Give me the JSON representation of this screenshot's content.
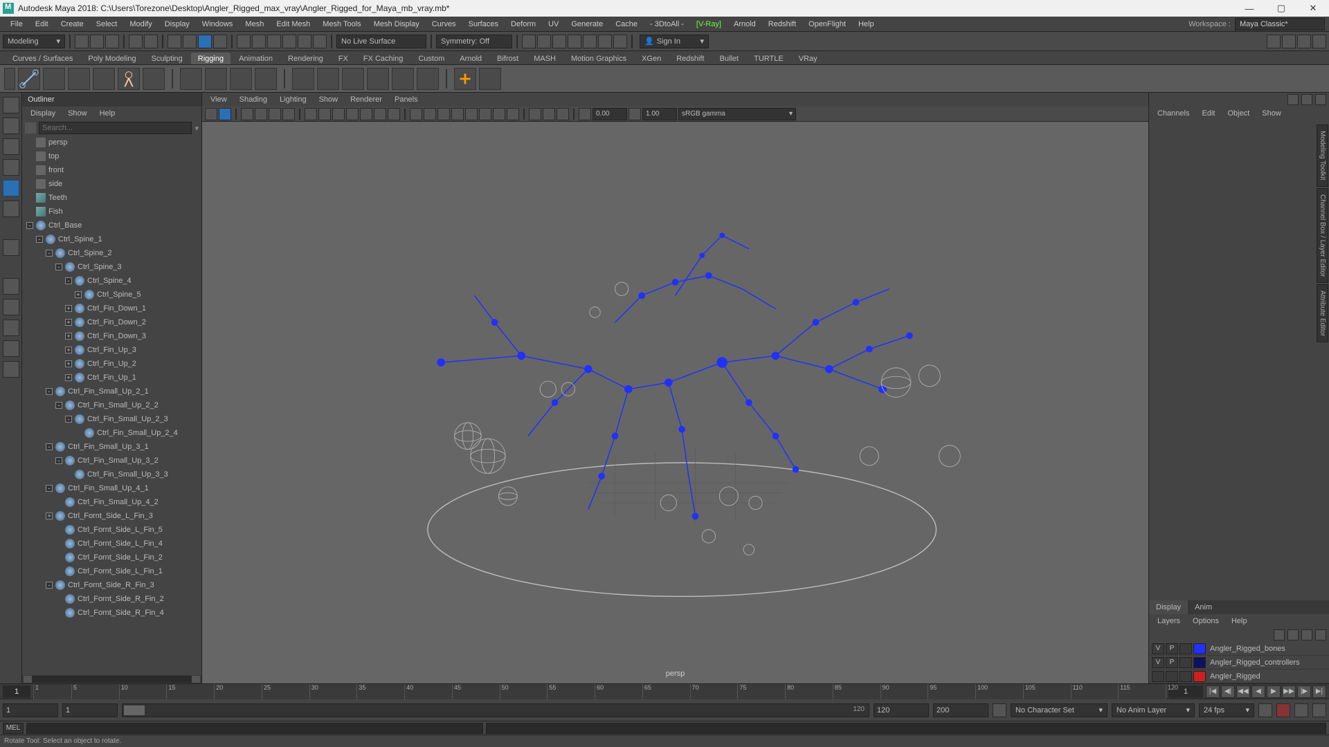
{
  "title": "Autodesk Maya 2018: C:\\Users\\Torezone\\Desktop\\Angler_Rigged_max_vray\\Angler_Rigged_for_Maya_mb_vray.mb*",
  "menubar": [
    "File",
    "Edit",
    "Create",
    "Select",
    "Modify",
    "Display",
    "Windows",
    "Mesh",
    "Edit Mesh",
    "Mesh Tools",
    "Mesh Display",
    "Curves",
    "Surfaces",
    "Deform",
    "UV",
    "Generate",
    "Cache",
    "- 3DtoAll -",
    "[V-Ray]",
    "Arnold",
    "Redshift",
    "OpenFlight",
    "Help"
  ],
  "workspace": {
    "label": "Workspace :",
    "value": "Maya Classic*"
  },
  "modeline": {
    "dropdown": "Modeling",
    "live_surface": "No Live Surface",
    "symmetry": "Symmetry: Off",
    "signin": "Sign In"
  },
  "shelf_tabs": [
    "Curves / Surfaces",
    "Poly Modeling",
    "Sculpting",
    "Rigging",
    "Animation",
    "Rendering",
    "FX",
    "FX Caching",
    "Custom",
    "Arnold",
    "Bifrost",
    "MASH",
    "Motion Graphics",
    "XGen",
    "Redshift",
    "Bullet",
    "TURTLE",
    "VRay"
  ],
  "shelf_active": "Rigging",
  "outliner": {
    "title": "Outliner",
    "menus": [
      "Display",
      "Show",
      "Help"
    ],
    "search_placeholder": "Search...",
    "items": [
      {
        "indent": 0,
        "type": "cam",
        "name": "persp",
        "exp": ""
      },
      {
        "indent": 0,
        "type": "cam",
        "name": "top",
        "exp": ""
      },
      {
        "indent": 0,
        "type": "cam",
        "name": "front",
        "exp": ""
      },
      {
        "indent": 0,
        "type": "cam",
        "name": "side",
        "exp": ""
      },
      {
        "indent": 0,
        "type": "mesh",
        "name": "Teeth",
        "exp": ""
      },
      {
        "indent": 0,
        "type": "mesh",
        "name": "Fish",
        "exp": ""
      },
      {
        "indent": 0,
        "type": "ctrl",
        "name": "Ctrl_Base",
        "exp": "-"
      },
      {
        "indent": 1,
        "type": "ctrl",
        "name": "Ctrl_Spine_1",
        "exp": "-"
      },
      {
        "indent": 2,
        "type": "ctrl",
        "name": "Ctrl_Spine_2",
        "exp": "-"
      },
      {
        "indent": 3,
        "type": "ctrl",
        "name": "Ctrl_Spine_3",
        "exp": "-"
      },
      {
        "indent": 4,
        "type": "ctrl",
        "name": "Ctrl_Spine_4",
        "exp": "-"
      },
      {
        "indent": 5,
        "type": "ctrl",
        "name": "Ctrl_Spine_5",
        "exp": "+"
      },
      {
        "indent": 4,
        "type": "ctrl",
        "name": "Ctrl_Fin_Down_1",
        "exp": "+"
      },
      {
        "indent": 4,
        "type": "ctrl",
        "name": "Ctrl_Fin_Down_2",
        "exp": "+"
      },
      {
        "indent": 4,
        "type": "ctrl",
        "name": "Ctrl_Fin_Down_3",
        "exp": "+"
      },
      {
        "indent": 4,
        "type": "ctrl",
        "name": "Ctrl_Fin_Up_3",
        "exp": "+"
      },
      {
        "indent": 4,
        "type": "ctrl",
        "name": "Ctrl_Fin_Up_2",
        "exp": "+"
      },
      {
        "indent": 4,
        "type": "ctrl",
        "name": "Ctrl_Fin_Up_1",
        "exp": "+"
      },
      {
        "indent": 2,
        "type": "ctrl",
        "name": "Ctrl_Fin_Small_Up_2_1",
        "exp": "-"
      },
      {
        "indent": 3,
        "type": "ctrl",
        "name": "Ctrl_Fin_Small_Up_2_2",
        "exp": "-"
      },
      {
        "indent": 4,
        "type": "ctrl",
        "name": "Ctrl_Fin_Small_Up_2_3",
        "exp": "-"
      },
      {
        "indent": 5,
        "type": "ctrl",
        "name": "Ctrl_Fin_Small_Up_2_4",
        "exp": ""
      },
      {
        "indent": 2,
        "type": "ctrl",
        "name": "Ctrl_Fin_Small_Up_3_1",
        "exp": "-"
      },
      {
        "indent": 3,
        "type": "ctrl",
        "name": "Ctrl_Fin_Small_Up_3_2",
        "exp": "-"
      },
      {
        "indent": 4,
        "type": "ctrl",
        "name": "Ctrl_Fin_Small_Up_3_3",
        "exp": ""
      },
      {
        "indent": 2,
        "type": "ctrl",
        "name": "Ctrl_Fin_Small_Up_4_1",
        "exp": "-"
      },
      {
        "indent": 3,
        "type": "ctrl",
        "name": "Ctrl_Fin_Small_Up_4_2",
        "exp": ""
      },
      {
        "indent": 2,
        "type": "ctrl",
        "name": "Ctrl_Fornt_Side_L_Fin_3",
        "exp": "+"
      },
      {
        "indent": 3,
        "type": "ctrl",
        "name": "Ctrl_Fornt_Side_L_Fin_5",
        "exp": ""
      },
      {
        "indent": 3,
        "type": "ctrl",
        "name": "Ctrl_Fornt_Side_L_Fin_4",
        "exp": ""
      },
      {
        "indent": 3,
        "type": "ctrl",
        "name": "Ctrl_Fornt_Side_L_Fin_2",
        "exp": ""
      },
      {
        "indent": 3,
        "type": "ctrl",
        "name": "Ctrl_Fornt_Side_L_Fin_1",
        "exp": ""
      },
      {
        "indent": 2,
        "type": "ctrl",
        "name": "Ctrl_Fornt_Side_R_Fin_3",
        "exp": "-"
      },
      {
        "indent": 3,
        "type": "ctrl",
        "name": "Ctrl_Fornt_Side_R_Fin_2",
        "exp": ""
      },
      {
        "indent": 3,
        "type": "ctrl",
        "name": "Ctrl_Fornt_Side_R_Fin_4",
        "exp": ""
      }
    ]
  },
  "viewport": {
    "menus": [
      "View",
      "Shading",
      "Lighting",
      "Show",
      "Renderer",
      "Panels"
    ],
    "field1": "0.00",
    "field2": "1.00",
    "gamma": "sRGB gamma",
    "persp_label": "persp"
  },
  "chmenu": [
    "Channels",
    "Edit",
    "Object",
    "Show"
  ],
  "layers": {
    "tabs": [
      "Display",
      "Anim"
    ],
    "menus": [
      "Layers",
      "Options",
      "Help"
    ],
    "rows": [
      {
        "v": "V",
        "p": "P",
        "color": "#2030ff",
        "name": "Angler_Rigged_bones"
      },
      {
        "v": "V",
        "p": "P",
        "color": "#101060",
        "name": "Angler_Rigged_controllers"
      },
      {
        "v": "",
        "p": "",
        "color": "#cc2020",
        "name": "Angler_Rigged"
      }
    ]
  },
  "timeline": {
    "current": "1",
    "end": "1",
    "ticks": [
      1,
      5,
      10,
      15,
      20,
      25,
      30,
      35,
      40,
      45,
      50,
      55,
      60,
      65,
      70,
      75,
      80,
      85,
      90,
      95,
      100,
      105,
      110,
      115,
      120
    ]
  },
  "range": {
    "start": "1",
    "playstart": "1",
    "playend": "120",
    "end": "200",
    "charset": "No Character Set",
    "animlayer": "No Anim Layer",
    "fps": "24 fps"
  },
  "cmd": {
    "lang": "MEL"
  },
  "status": "Rotate Tool: Select an object to rotate.",
  "right_tabs": [
    "Modeling Toolkit",
    "Channel Box / Layer Editor",
    "Attribute Editor"
  ]
}
